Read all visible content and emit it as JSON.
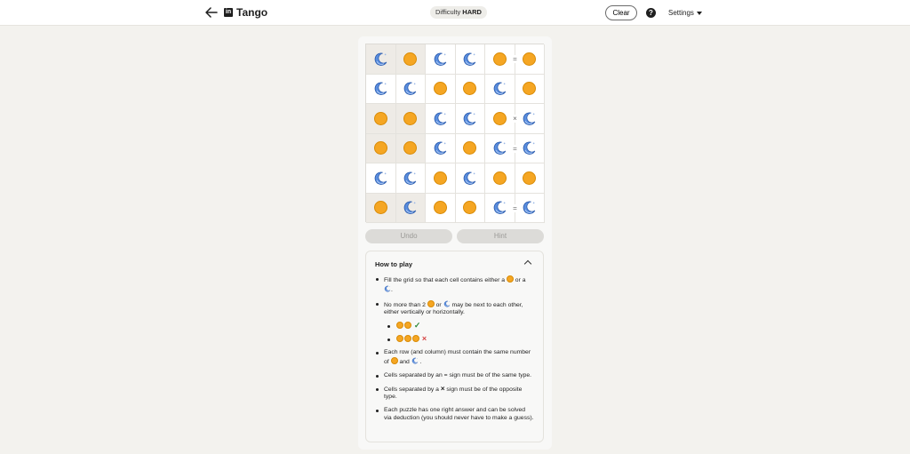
{
  "header": {
    "brand": "Tango",
    "difficulty_label": "Difficulty",
    "difficulty_value": "HARD",
    "clear_label": "Clear",
    "help_glyph": "?",
    "settings_label": "Settings"
  },
  "grid": {
    "rows": [
      [
        "moon",
        "sun",
        "moon",
        "moon",
        "sun",
        "sun"
      ],
      [
        "moon",
        "moon",
        "sun",
        "sun",
        "moon",
        "sun"
      ],
      [
        "sun",
        "sun",
        "moon",
        "moon",
        "sun",
        "moon"
      ],
      [
        "sun",
        "sun",
        "moon",
        "sun",
        "moon",
        "moon"
      ],
      [
        "moon",
        "moon",
        "sun",
        "moon",
        "sun",
        "sun"
      ],
      [
        "sun",
        "moon",
        "sun",
        "sun",
        "moon",
        "moon"
      ]
    ],
    "locked": [
      [
        true,
        true,
        false,
        false,
        false,
        false
      ],
      [
        false,
        false,
        false,
        false,
        false,
        false
      ],
      [
        true,
        true,
        false,
        false,
        false,
        false
      ],
      [
        true,
        true,
        false,
        false,
        false,
        false
      ],
      [
        false,
        false,
        false,
        false,
        false,
        false
      ],
      [
        true,
        true,
        false,
        false,
        false,
        false
      ]
    ],
    "separators": [
      {
        "row": 0,
        "col": 4,
        "symbol": "="
      },
      {
        "row": 2,
        "col": 4,
        "symbol": "×"
      },
      {
        "row": 3,
        "col": 4,
        "symbol": "="
      },
      {
        "row": 5,
        "col": 4,
        "symbol": "="
      }
    ]
  },
  "actions": {
    "undo_label": "Undo",
    "hint_label": "Hint"
  },
  "how_to_play": {
    "title": "How to play",
    "rule1_a": "Fill the grid so that each cell contains either a",
    "rule1_b": "or a",
    "rule1_c": ".",
    "rule2_a": "No more than 2",
    "rule2_b": "or",
    "rule2_c": "may be next to each other, either vertically or horizontally.",
    "rule2_ok": "✓",
    "rule2_bad": "×",
    "rule3_a": "Each row (and column) must contain the same number of",
    "rule3_b": "and",
    "rule3_c": ".",
    "rule4": "Cells separated by an = sign must be of the same type.",
    "rule5_a": "Cells separated by a",
    "rule5_x": "×",
    "rule5_b": "sign must be of the opposite type.",
    "rule6": "Each puzzle has one right answer and can be solved via deduction (you should never have to make a guess)."
  },
  "colors": {
    "sun": "#f5a623",
    "moon": "#4a7fd6",
    "locked_cell": "#eeebe6",
    "page_bg": "#f3f2ee"
  },
  "icons": {
    "back": "arrow-left-icon",
    "logo": "linkedin-icon",
    "help": "question-circle-icon",
    "settings_caret": "caret-down-icon",
    "collapse": "chevron-up-icon"
  }
}
